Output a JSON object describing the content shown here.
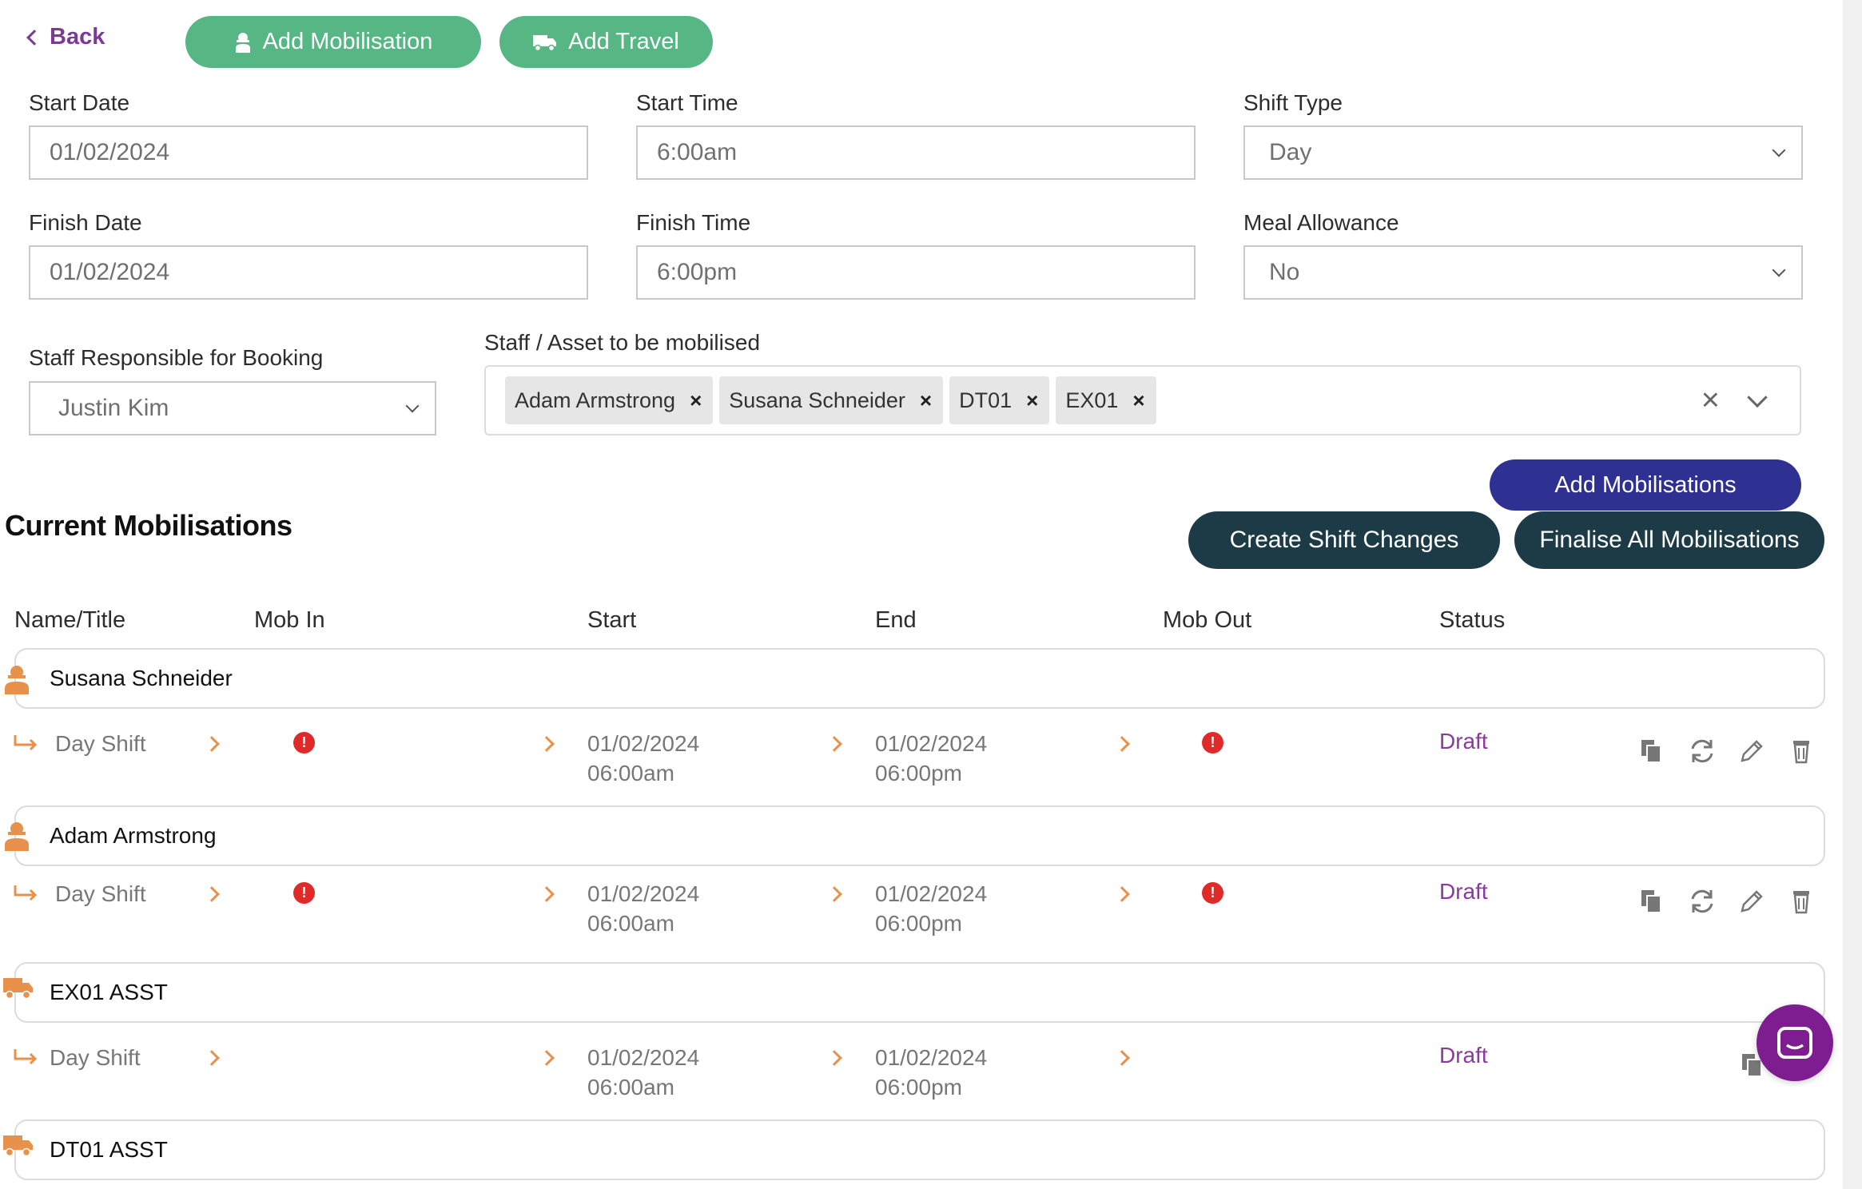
{
  "nav": {
    "back_label": "Back"
  },
  "header_buttons": {
    "add_mobilisation": "Add Mobilisation",
    "add_travel": "Add Travel"
  },
  "form": {
    "start_date": {
      "label": "Start Date",
      "value": "01/02/2024"
    },
    "start_time": {
      "label": "Start Time",
      "value": "6:00am"
    },
    "shift_type": {
      "label": "Shift Type",
      "value": "Day"
    },
    "finish_date": {
      "label": "Finish Date",
      "value": "01/02/2024"
    },
    "finish_time": {
      "label": "Finish Time",
      "value": "6:00pm"
    },
    "meal_allowance": {
      "label": "Meal Allowance",
      "value": "No"
    },
    "staff_responsible": {
      "label": "Staff Responsible for Booking",
      "value": "Justin Kim"
    },
    "staff_asset": {
      "label": "Staff / Asset to be mobilised",
      "chips": [
        "Adam Armstrong",
        "Susana Schneider",
        "DT01",
        "EX01"
      ]
    }
  },
  "actions": {
    "add_mobilisations": "Add Mobilisations",
    "create_shift_changes": "Create Shift Changes",
    "finalise_all": "Finalise All Mobilisations"
  },
  "section_title": "Current Mobilisations",
  "table": {
    "headers": [
      "Name/Title",
      "Mob In",
      "Start",
      "End",
      "Mob Out",
      "Status"
    ],
    "groups": [
      {
        "name": "Susana Schneider",
        "icon": "person-icon",
        "shift": "Day Shift",
        "start_date": "01/02/2024",
        "start_time": "06:00am",
        "end_date": "01/02/2024",
        "end_time": "06:00pm",
        "status": "Draft"
      },
      {
        "name": "Adam Armstrong",
        "icon": "person-icon",
        "shift": "Day Shift",
        "start_date": "01/02/2024",
        "start_time": "06:00am",
        "end_date": "01/02/2024",
        "end_time": "06:00pm",
        "status": "Draft"
      },
      {
        "name": "EX01 ASST",
        "icon": "truck-icon",
        "shift": "Day Shift",
        "start_date": "01/02/2024",
        "start_time": "06:00am",
        "end_date": "01/02/2024",
        "end_time": "06:00pm",
        "status": "Draft"
      },
      {
        "name": "DT01 ASST",
        "icon": "truck-icon"
      }
    ]
  },
  "colors": {
    "green": "#57b784",
    "navy": "#2e3191",
    "dark_teal": "#1d3b47",
    "purple": "#7b3a96",
    "orange": "#e8914a",
    "red": "#e02a2a"
  }
}
